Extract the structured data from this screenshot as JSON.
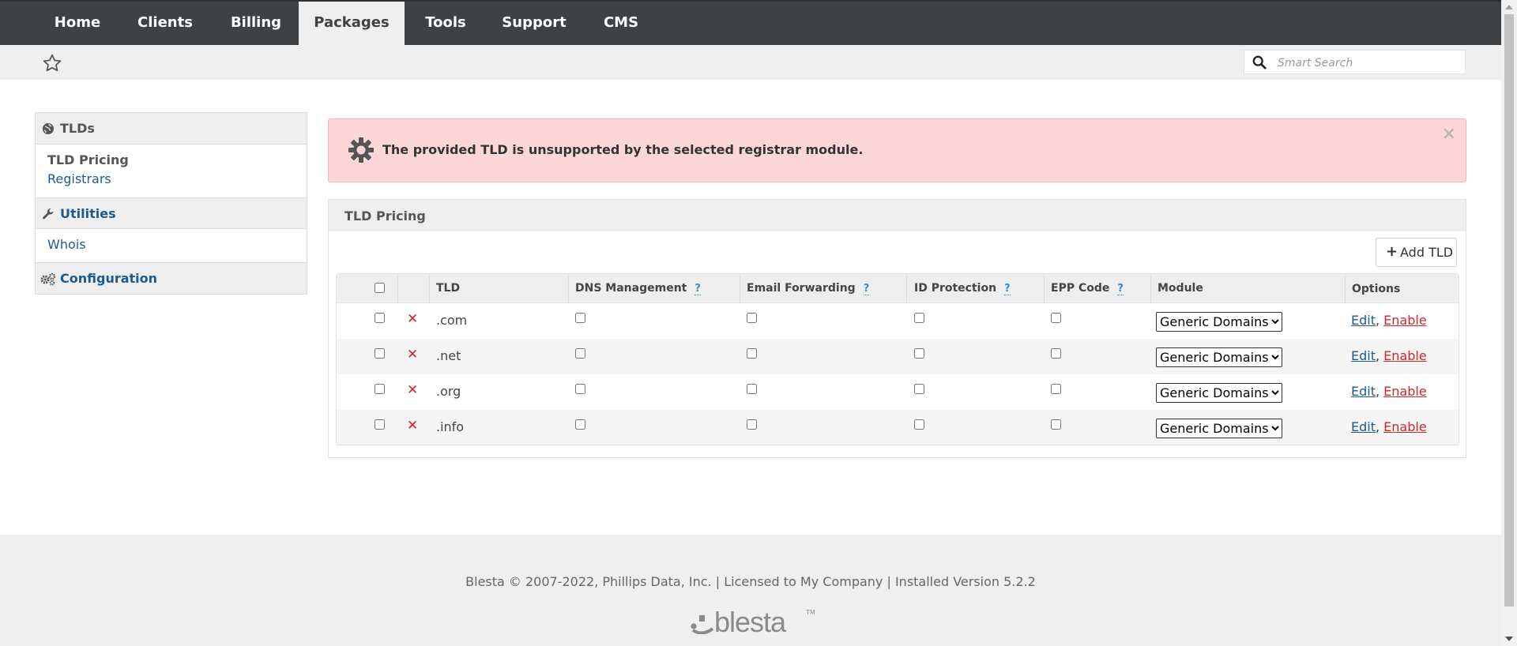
{
  "nav": {
    "tabs": [
      {
        "label": "Home"
      },
      {
        "label": "Clients"
      },
      {
        "label": "Billing"
      },
      {
        "label": "Packages",
        "active": true
      },
      {
        "label": "Tools"
      },
      {
        "label": "Support"
      },
      {
        "label": "CMS"
      }
    ]
  },
  "search": {
    "placeholder": "Smart Search",
    "value": ""
  },
  "sidebar": {
    "sections": [
      {
        "title": "TLDs",
        "icon": "globe-icon",
        "items": [
          {
            "label": "TLD Pricing",
            "current": true
          },
          {
            "label": "Registrars"
          }
        ]
      },
      {
        "title": "Utilities",
        "icon": "wrench-icon",
        "items": [
          {
            "label": "Whois"
          }
        ]
      },
      {
        "title": "Configuration",
        "icon": "gears-icon",
        "items": []
      }
    ]
  },
  "alert": {
    "message": "The provided TLD is unsupported by the selected registrar module.",
    "close": "×",
    "icon": "gear-icon",
    "color": "#fdd7d7"
  },
  "panel": {
    "title": "TLD Pricing",
    "add_button": "Add TLD",
    "add_icon": "+"
  },
  "table": {
    "headers": {
      "tld": "TLD",
      "dns": "DNS Management",
      "email": "Email Forwarding",
      "id_protection": "ID Protection",
      "epp": "EPP Code",
      "module": "Module",
      "options": "Options",
      "help": "?"
    },
    "rows": [
      {
        "tld": ".com",
        "module": "Generic Domains",
        "edit": "Edit",
        "separator": ",",
        "enable": "Enable"
      },
      {
        "tld": ".net",
        "module": "Generic Domains",
        "edit": "Edit",
        "separator": ",",
        "enable": "Enable"
      },
      {
        "tld": ".org",
        "module": "Generic Domains",
        "edit": "Edit",
        "separator": ",",
        "enable": "Enable"
      },
      {
        "tld": ".info",
        "module": "Generic Domains",
        "edit": "Edit",
        "separator": ",",
        "enable": "Enable"
      }
    ],
    "delete_glyph": "✕",
    "module_options": [
      "Generic Domains"
    ]
  },
  "footer": {
    "copyright": "Blesta © 2007-2022, Phillips Data, Inc. | Licensed to My Company | Installed Version 5.2.2",
    "logo_text": "blesta",
    "logo_tm": "TM"
  },
  "colors": {
    "nav_bg": "#3f4245",
    "link": "#1d5b8f",
    "danger": "#c9282d",
    "delete": "#d9202b",
    "help": "#3c8dbc"
  }
}
